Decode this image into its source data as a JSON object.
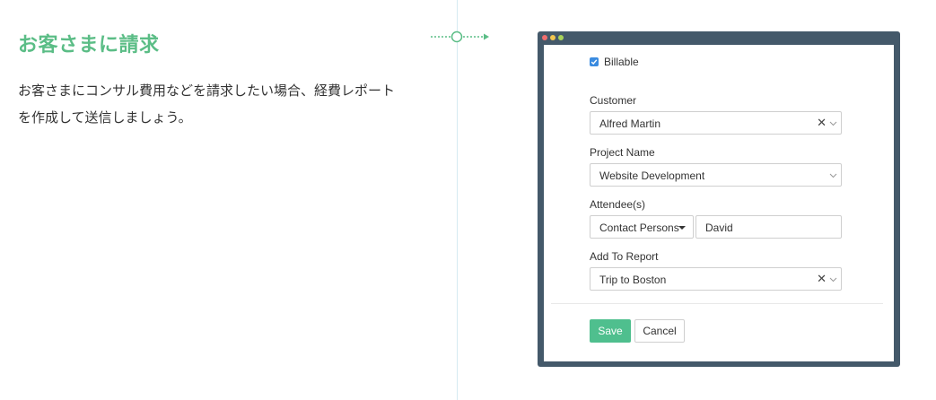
{
  "intro": {
    "heading": "お客さまに請求",
    "description": "お客さまにコンサル費用などを請求したい場合、経費レポートを作成して送信しましょう。"
  },
  "colors": {
    "accent_green": "#5bbd86",
    "window_frame": "#44596a",
    "checkbox_blue": "#3a8be0",
    "save_button": "#4fbf8e"
  },
  "window": {
    "controls": [
      "close-dot",
      "minimize-dot",
      "maximize-dot"
    ]
  },
  "form": {
    "billable": {
      "label": "Billable",
      "checked": true
    },
    "customer": {
      "label": "Customer",
      "value": "Alfred Martin",
      "clear": "✕"
    },
    "project": {
      "label": "Project Name",
      "value": "Website Development"
    },
    "attendees": {
      "label": "Attendee(s)",
      "type_value": "Contact Persons",
      "name_value": "David"
    },
    "report": {
      "label": "Add To Report",
      "value": "Trip to Boston",
      "clear": "✕"
    },
    "save_label": "Save",
    "cancel_label": "Cancel"
  }
}
